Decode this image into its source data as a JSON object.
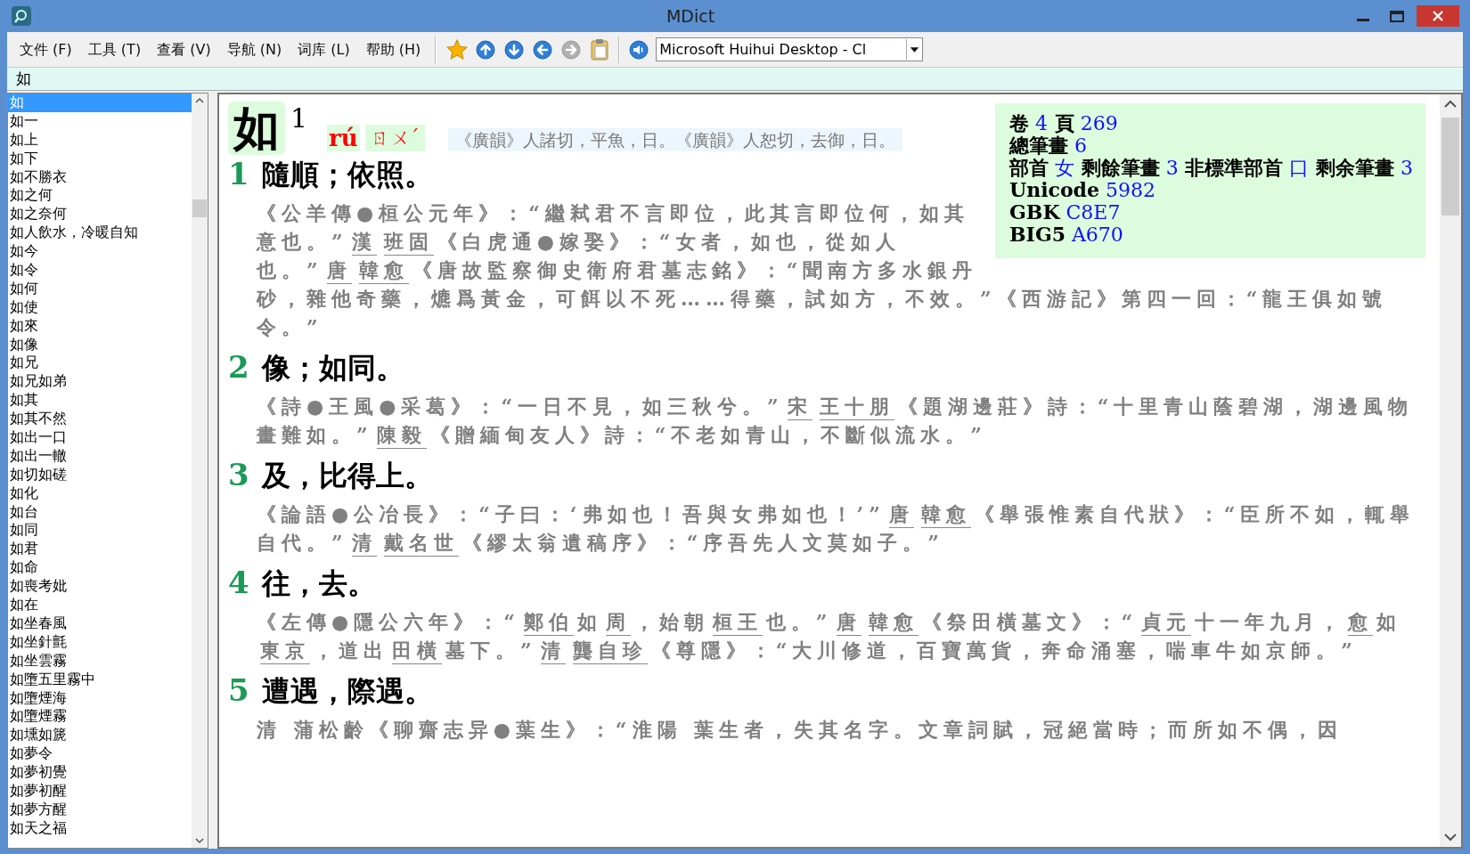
{
  "window": {
    "title": "MDict"
  },
  "menu": [
    "文件 (F)",
    "工具 (T)",
    "查看 (V)",
    "导航 (N)",
    "词库 (L)",
    "帮助 (H)"
  ],
  "toolbar": [
    {
      "kind": "star",
      "disabled": false
    },
    {
      "kind": "up",
      "disabled": false
    },
    {
      "kind": "down",
      "disabled": false
    },
    {
      "kind": "back",
      "disabled": false
    },
    {
      "kind": "forward",
      "disabled": true
    },
    {
      "kind": "clipboard",
      "disabled": false
    },
    {
      "kind": "speaker",
      "disabled": false
    }
  ],
  "voice_select": {
    "value": "Microsoft Huihui Desktop - Cl"
  },
  "search": {
    "value": "如"
  },
  "sidebar": {
    "items": [
      {
        "label": "如",
        "selected": true
      },
      {
        "label": "如一",
        "selected": false
      },
      {
        "label": "如上",
        "selected": false
      },
      {
        "label": "如下",
        "selected": false
      },
      {
        "label": "如不勝衣",
        "selected": false
      },
      {
        "label": "如之何",
        "selected": false
      },
      {
        "label": "如之奈何",
        "selected": false
      },
      {
        "label": "如人飲水，冷暖自知",
        "selected": false
      },
      {
        "label": "如今",
        "selected": false
      },
      {
        "label": "如令",
        "selected": false
      },
      {
        "label": "如何",
        "selected": false
      },
      {
        "label": "如使",
        "selected": false
      },
      {
        "label": "如來",
        "selected": false
      },
      {
        "label": "如像",
        "selected": false
      },
      {
        "label": "如兄",
        "selected": false
      },
      {
        "label": "如兄如弟",
        "selected": false
      },
      {
        "label": "如其",
        "selected": false
      },
      {
        "label": "如其不然",
        "selected": false
      },
      {
        "label": "如出一口",
        "selected": false
      },
      {
        "label": "如出一轍",
        "selected": false
      },
      {
        "label": "如切如磋",
        "selected": false
      },
      {
        "label": "如化",
        "selected": false
      },
      {
        "label": "如台",
        "selected": false
      },
      {
        "label": "如同",
        "selected": false
      },
      {
        "label": "如君",
        "selected": false
      },
      {
        "label": "如命",
        "selected": false
      },
      {
        "label": "如喪考妣",
        "selected": false
      },
      {
        "label": "如在",
        "selected": false
      },
      {
        "label": "如坐春風",
        "selected": false
      },
      {
        "label": "如坐針氈",
        "selected": false
      },
      {
        "label": "如坐雲霧",
        "selected": false
      },
      {
        "label": "如墮五里霧中",
        "selected": false
      },
      {
        "label": "如墮煙海",
        "selected": false
      },
      {
        "label": "如墮煙霧",
        "selected": false
      },
      {
        "label": "如壎如篪",
        "selected": false
      },
      {
        "label": "如夢令",
        "selected": false
      },
      {
        "label": "如夢初覺",
        "selected": false
      },
      {
        "label": "如夢初醒",
        "selected": false
      },
      {
        "label": "如夢方醒",
        "selected": false
      },
      {
        "label": "如天之福",
        "selected": false
      }
    ]
  },
  "entry": {
    "headword": "如",
    "superscript": "1",
    "pinyin": "rú",
    "zhuyin": "ㄖㄨˊ",
    "rhyme_notes": "《廣韻》人諸切，平魚，日。《廣韻》人恕切，去御，日。",
    "info": [
      [
        {
          "text": "卷",
          "kind": "label"
        },
        {
          "text": "4",
          "kind": "value"
        },
        {
          "text": "頁",
          "kind": "label"
        },
        {
          "text": "269",
          "kind": "value"
        }
      ],
      [
        {
          "text": "總筆畫",
          "kind": "label"
        },
        {
          "text": "6",
          "kind": "value"
        }
      ],
      [
        {
          "text": "部首",
          "kind": "label"
        },
        {
          "text": "女",
          "kind": "value"
        },
        {
          "text": "剩餘筆畫",
          "kind": "label"
        },
        {
          "text": "3",
          "kind": "value"
        },
        {
          "text": "非標準部首",
          "kind": "label"
        },
        {
          "text": "口",
          "kind": "value"
        },
        {
          "text": "剩余筆畫",
          "kind": "label"
        },
        {
          "text": "3",
          "kind": "value"
        }
      ],
      [
        {
          "text": "Unicode",
          "kind": "label"
        },
        {
          "text": "5982",
          "kind": "value"
        }
      ],
      [
        {
          "text": "GBK",
          "kind": "label"
        },
        {
          "text": "C8E7",
          "kind": "value"
        }
      ],
      [
        {
          "text": "BIG5",
          "kind": "label"
        },
        {
          "text": "A670",
          "kind": "value"
        }
      ]
    ],
    "senses": [
      {
        "number": "1",
        "definition": "隨順；依照。",
        "quote": [
          {
            "text": "《公羊傳●桓公元年》：“繼弒君不言即位，此其言即位何，如其意也。”",
            "underlined": false
          },
          {
            "text": "漢",
            "underlined": true
          },
          {
            "text": "班固",
            "underlined": true
          },
          {
            "text": "《白虎通●嫁娶》：“女者，如也，從如人也。”",
            "underlined": false
          },
          {
            "text": "唐",
            "underlined": true
          },
          {
            "text": "韓愈",
            "underlined": true
          },
          {
            "text": "《唐故監察御史衛府君墓志銘》：“聞南方多水銀丹砂，雜他奇藥，爊爲黃金，可餌以不死……得藥，試如方，不效。”《西游記》第四一回：“龍王俱如號令。”",
            "underlined": false
          }
        ]
      },
      {
        "number": "2",
        "definition": "像；如同。",
        "quote": [
          {
            "text": "《詩●王風●采葛》：“一日不見，如三秋兮。”",
            "underlined": false
          },
          {
            "text": "宋",
            "underlined": true
          },
          {
            "text": "王十朋",
            "underlined": true
          },
          {
            "text": "《題湖邊莊》詩：“十里青山蔭碧湖，湖邊風物畫難如。”",
            "underlined": false
          },
          {
            "text": "陳毅",
            "underlined": true
          },
          {
            "text": "《贈緬甸友人》詩：“不老如青山，不斷似流水。”",
            "underlined": false
          }
        ]
      },
      {
        "number": "3",
        "definition": "及，比得上。",
        "quote": [
          {
            "text": "《論語●公冶長》：“子曰：‘弗如也！吾與女弗如也！’”",
            "underlined": false
          },
          {
            "text": "唐",
            "underlined": true
          },
          {
            "text": "韓愈",
            "underlined": true
          },
          {
            "text": "《舉張惟素自代狀》：“臣所不如，輒舉自代。”",
            "underlined": false
          },
          {
            "text": "清",
            "underlined": true
          },
          {
            "text": "戴名世",
            "underlined": true
          },
          {
            "text": "《繆太翁遺稿序》：“序吾先人文莫如子。”",
            "underlined": false
          }
        ]
      },
      {
        "number": "4",
        "definition": "往，去。",
        "quote": [
          {
            "text": "《左傳●隱公六年》：“",
            "underlined": false
          },
          {
            "text": "鄭伯",
            "underlined": true
          },
          {
            "text": "如",
            "underlined": false
          },
          {
            "text": "周",
            "underlined": true
          },
          {
            "text": "，始朝",
            "underlined": false
          },
          {
            "text": "桓王",
            "underlined": true
          },
          {
            "text": "也。”",
            "underlined": false
          },
          {
            "text": "唐",
            "underlined": true
          },
          {
            "text": "韓愈",
            "underlined": true
          },
          {
            "text": "《祭田橫墓文》：“",
            "underlined": false
          },
          {
            "text": "貞元",
            "underlined": true
          },
          {
            "text": "十一年九月，",
            "underlined": false
          },
          {
            "text": "愈",
            "underlined": true
          },
          {
            "text": "如",
            "underlined": false
          },
          {
            "text": "東京",
            "underlined": true
          },
          {
            "text": "，道出",
            "underlined": false
          },
          {
            "text": "田橫",
            "underlined": true
          },
          {
            "text": "墓下。”",
            "underlined": false
          },
          {
            "text": "清",
            "underlined": true
          },
          {
            "text": "龔自珍",
            "underlined": true
          },
          {
            "text": "《尊隱》：“大川修道，百寶萬貨，奔命涌塞，喘車牛如京師。”",
            "underlined": false
          }
        ]
      },
      {
        "number": "5",
        "definition": "遭遇，際遇。",
        "quote": [
          {
            "text": "清 蒲松齡《聊齋志异●葉生》：“淮陽 葉生者，失其名字。文章詞賦，冠絕當時；而所如不偶，因",
            "underlined": false
          }
        ]
      }
    ]
  }
}
